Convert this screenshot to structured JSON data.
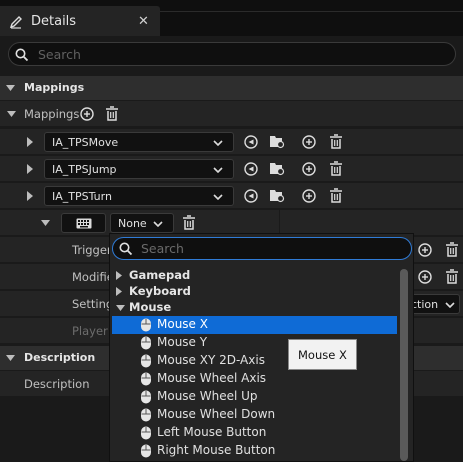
{
  "tab": {
    "title": "Details",
    "close": "✕"
  },
  "search": {
    "placeholder": "Search"
  },
  "sections": {
    "mappings_header": "Mappings",
    "mappings_label": "Mappings",
    "description_header": "Description",
    "description_label": "Description"
  },
  "mappings": [
    {
      "name": "IA_TPSMove"
    },
    {
      "name": "IA_TPSJump"
    },
    {
      "name": "IA_TPSTurn"
    }
  ],
  "key_row": {
    "value": "None"
  },
  "sub_rows": {
    "trigger": "Trigger",
    "modifiers": "Modifie",
    "settings": "Setting",
    "player": "Player",
    "settings_value": "ction"
  },
  "dropdown": {
    "search_placeholder": "Search",
    "categories": [
      "Gamepad",
      "Keyboard",
      "Mouse"
    ],
    "items": [
      "Mouse X",
      "Mouse Y",
      "Mouse XY 2D-Axis",
      "Mouse Wheel Axis",
      "Mouse Wheel Up",
      "Mouse Wheel Down",
      "Left Mouse Button",
      "Right Mouse Button"
    ],
    "selected": "Mouse X"
  },
  "tooltip": {
    "text": "Mouse X"
  },
  "colors": {
    "accent": "#0f6bd6",
    "focus": "#2f7bd6",
    "panel": "#242424",
    "header": "#2e2e2e"
  },
  "icons": [
    "pencil-icon",
    "search-icon",
    "plus-icon",
    "trash-icon",
    "keyboard-icon",
    "reset-arrow-icon",
    "browse-folder-icon",
    "mouse-icon"
  ]
}
